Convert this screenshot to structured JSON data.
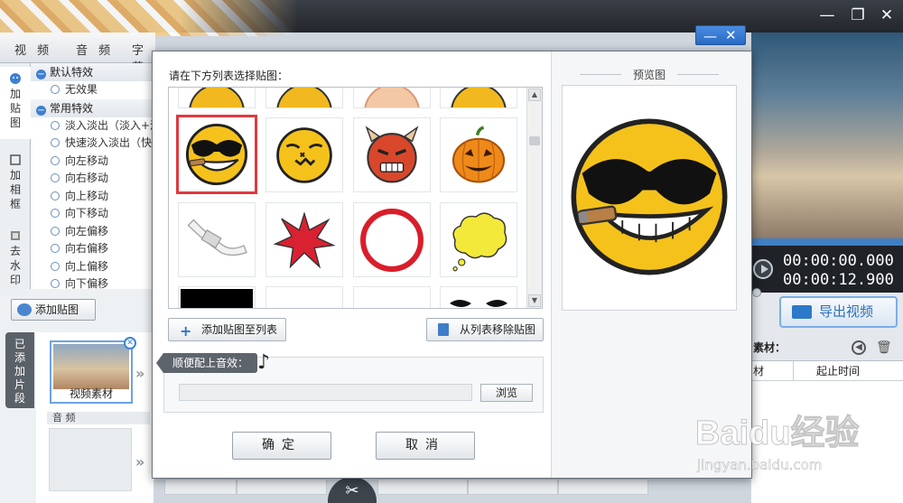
{
  "app": {
    "top_tabs": [
      "视 频",
      "音 频",
      "字幕"
    ],
    "side_tabs": [
      "加贴图",
      "加相框",
      "去水印"
    ],
    "effect_groups": [
      {
        "label": "默认特效",
        "items": [
          "无效果"
        ]
      },
      {
        "label": "常用特效",
        "items": [
          "淡入淡出（淡入+淡",
          "快速淡入淡出（快",
          "向左移动",
          "向右移动",
          "向上移动",
          "向下移动",
          "向左偏移",
          "向右偏移",
          "向上偏移",
          "向下偏移"
        ]
      }
    ],
    "add_sticker_button": "添加贴图",
    "added_clips_tab": "已添加片段",
    "clip_label": "视频素材",
    "audio_label": "音 频",
    "timecode_current": "00:00:00.000",
    "timecode_total": "00:00:12.900",
    "export_button": "导出视频",
    "material_header": "素材：",
    "material_columns": [
      "材",
      "起止时间"
    ]
  },
  "dialog": {
    "instruction": "请在下方列表选择贴图：",
    "add_to_list_button": "添加贴图至列表",
    "remove_from_list_button": "从列表移除贴图",
    "sound_tag": "顺便配上音效：",
    "browse_button": "浏览",
    "ok_button": "确定",
    "cancel_button": "取消",
    "preview_title": "预览图",
    "selected_sticker": "cool-smiley-cigar",
    "stickers": [
      "partial-smiley-1",
      "partial-smiley-2",
      "partial-face-skin",
      "partial-smiley-4",
      "cool-smiley-cigar",
      "dizzy-smiley",
      "devil-face",
      "pumpkin",
      "bandage",
      "red-burst",
      "red-ring",
      "yellow-cloud-bubble",
      "black-bar",
      "blank",
      "blank",
      "mustache"
    ],
    "colors": {
      "accent": "#2a6bc4",
      "selection": "#e0393f"
    }
  },
  "watermark": {
    "brand": "Baidu经验",
    "url": "jingyan.baidu.com"
  }
}
